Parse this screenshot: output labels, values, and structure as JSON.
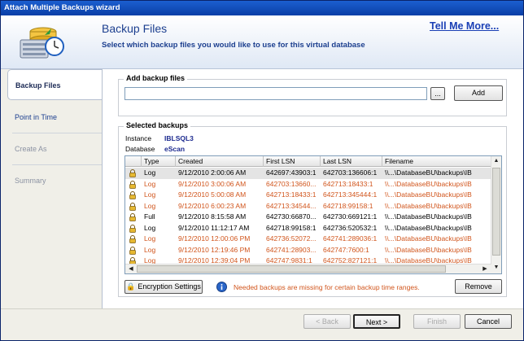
{
  "window": {
    "title": "Attach Multiple Backups wizard"
  },
  "header": {
    "title": "Backup Files",
    "subtitle": "Select which backup files you would like to use for this virtual database",
    "tell_me_more": "Tell Me More..."
  },
  "sidebar": {
    "items": [
      {
        "label": "Backup Files",
        "state": "active"
      },
      {
        "label": "Point in Time",
        "state": "enabled"
      },
      {
        "label": "Create As",
        "state": "disabled"
      },
      {
        "label": "Summary",
        "state": "disabled"
      }
    ]
  },
  "add_backup": {
    "legend": "Add backup files",
    "path_value": "",
    "browse_label": "...",
    "add_label": "Add"
  },
  "selected": {
    "legend": "Selected backups",
    "instance_label": "Instance",
    "instance_value": "IBLSQL3",
    "database_label": "Database",
    "database_value": "eScan",
    "columns": [
      "Type",
      "Created",
      "First LSN",
      "Last LSN",
      "Filename"
    ],
    "rows": [
      {
        "type": "Log",
        "created": "9/12/2010 2:00:06 AM",
        "first_lsn": "642697:43903:1",
        "last_lsn": "642703:136606:1",
        "filename": "\\\\...\\DatabaseBU\\backups\\IB",
        "color": "selected"
      },
      {
        "type": "Log",
        "created": "9/12/2010 3:00:06 AM",
        "first_lsn": "642703:13660...",
        "last_lsn": "642713:18433:1",
        "filename": "\\\\...\\DatabaseBU\\backups\\IB",
        "color": "orange"
      },
      {
        "type": "Log",
        "created": "9/12/2010 5:00:08 AM",
        "first_lsn": "642713:18433:1",
        "last_lsn": "642713:345444:1",
        "filename": "\\\\...\\DatabaseBU\\backups\\IB",
        "color": "orange"
      },
      {
        "type": "Log",
        "created": "9/12/2010 6:00:23 AM",
        "first_lsn": "642713:34544...",
        "last_lsn": "642718:99158:1",
        "filename": "\\\\...\\DatabaseBU\\backups\\IB",
        "color": "orange"
      },
      {
        "type": "Full",
        "created": "9/12/2010 8:15:58 AM",
        "first_lsn": "642730:66870...",
        "last_lsn": "642730:669121:1",
        "filename": "\\\\...\\DatabaseBU\\backups\\IB",
        "color": "normal"
      },
      {
        "type": "Log",
        "created": "9/12/2010 11:12:17 AM",
        "first_lsn": "642718:99158:1",
        "last_lsn": "642736:520532:1",
        "filename": "\\\\...\\DatabaseBU\\backups\\IB",
        "color": "normal"
      },
      {
        "type": "Log",
        "created": "9/12/2010 12:00:06 PM",
        "first_lsn": "642736:52072...",
        "last_lsn": "642741:289036:1",
        "filename": "\\\\...\\DatabaseBU\\backups\\IB",
        "color": "orange"
      },
      {
        "type": "Log",
        "created": "9/12/2010 12:19:46 PM",
        "first_lsn": "642741:28903...",
        "last_lsn": "642747:7600:1",
        "filename": "\\\\...\\DatabaseBU\\backups\\IB",
        "color": "orange"
      },
      {
        "type": "Log",
        "created": "9/12/2010 12:39:04 PM",
        "first_lsn": "642747:9831:1",
        "last_lsn": "642752:827121:1",
        "filename": "\\\\...\\DatabaseBU\\backups\\IB",
        "color": "orange"
      }
    ],
    "encryption_label": "Encryption Settings",
    "info_text": "Needed backups are missing for certain backup time ranges.",
    "remove_label": "Remove"
  },
  "footer": {
    "back_label": "< Back",
    "next_label": "Next >",
    "finish_label": "Finish",
    "cancel_label": "Cancel"
  },
  "colors": {
    "title_bar": "#0a3ea6",
    "header_text": "#1c3f8f",
    "warning_orange": "#d1551c",
    "link_blue": "#1a3fb5"
  }
}
